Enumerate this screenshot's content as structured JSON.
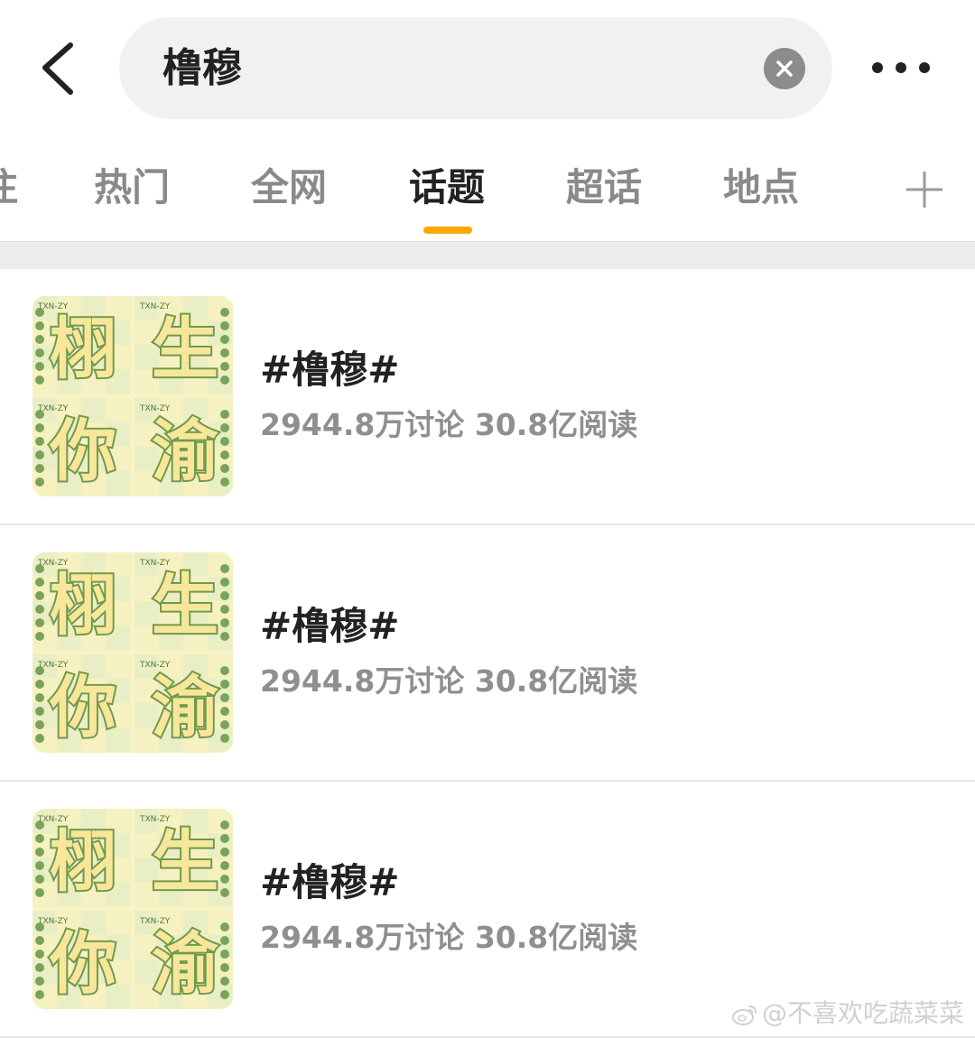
{
  "search": {
    "query": "橹穆"
  },
  "icons": {
    "back": "chevron-left-icon",
    "clear": "close-circle-icon",
    "more": "more-dots-icon",
    "add_tab": "plus-icon",
    "watermark": "weibo-icon"
  },
  "tabs": [
    {
      "label": "注"
    },
    {
      "label": "热门"
    },
    {
      "label": "全网"
    },
    {
      "label": "话题",
      "active": true
    },
    {
      "label": "超话"
    },
    {
      "label": "地点"
    }
  ],
  "topics": [
    {
      "title": "#橹穆#",
      "meta": "2944.8万讨论 30.8亿阅读",
      "thumb_chars": [
        "栩",
        "生",
        "你",
        "渝"
      ],
      "thumb_tag": "TXN-ZY"
    },
    {
      "title": "#橹穆#",
      "meta": "2944.8万讨论 30.8亿阅读",
      "thumb_chars": [
        "栩",
        "生",
        "你",
        "渝"
      ],
      "thumb_tag": "TXN-ZY"
    },
    {
      "title": "#橹穆#",
      "meta": "2944.8万讨论 30.8亿阅读",
      "thumb_chars": [
        "栩",
        "生",
        "你",
        "渝"
      ],
      "thumb_tag": "TXN-ZY"
    }
  ],
  "watermark": {
    "text": "@不喜欢吃蔬菜菜"
  },
  "colors": {
    "accent": "#ffa800",
    "tab_active": "#222222",
    "tab_inactive": "#8a8a8a",
    "meta_text": "#8f8f8f",
    "search_bg": "#f1f1f1"
  }
}
